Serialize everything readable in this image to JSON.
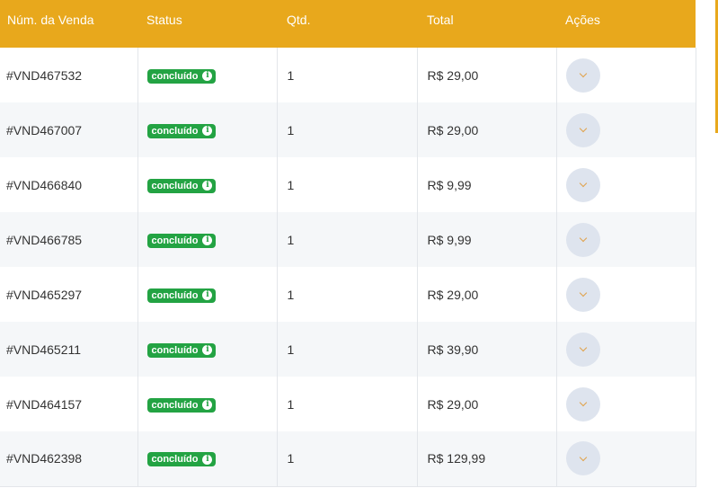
{
  "table": {
    "headers": {
      "num": "Núm. da Venda",
      "status": "Status",
      "qtd": "Qtd.",
      "total": "Total",
      "acoes": "Ações"
    },
    "rows": [
      {
        "num": "#VND467532",
        "status": "concluído",
        "qtd": "1",
        "total": "R$ 29,00"
      },
      {
        "num": "#VND467007",
        "status": "concluído",
        "qtd": "1",
        "total": "R$ 29,00"
      },
      {
        "num": "#VND466840",
        "status": "concluído",
        "qtd": "1",
        "total": "R$ 9,99"
      },
      {
        "num": "#VND466785",
        "status": "concluído",
        "qtd": "1",
        "total": "R$ 9,99"
      },
      {
        "num": "#VND465297",
        "status": "concluído",
        "qtd": "1",
        "total": "R$ 29,00"
      },
      {
        "num": "#VND465211",
        "status": "concluído",
        "qtd": "1",
        "total": "R$ 39,90"
      },
      {
        "num": "#VND464157",
        "status": "concluído",
        "qtd": "1",
        "total": "R$ 29,00"
      },
      {
        "num": "#VND462398",
        "status": "concluído",
        "qtd": "1",
        "total": "R$ 129,99"
      }
    ]
  },
  "icons": {
    "status_info": "info-icon",
    "action": "chevron-down-icon"
  },
  "colors": {
    "header_bg": "#e8a81c",
    "badge_bg": "#23a343",
    "action_btn_bg": "#dee4ee",
    "chevron": "#e0a24a"
  }
}
